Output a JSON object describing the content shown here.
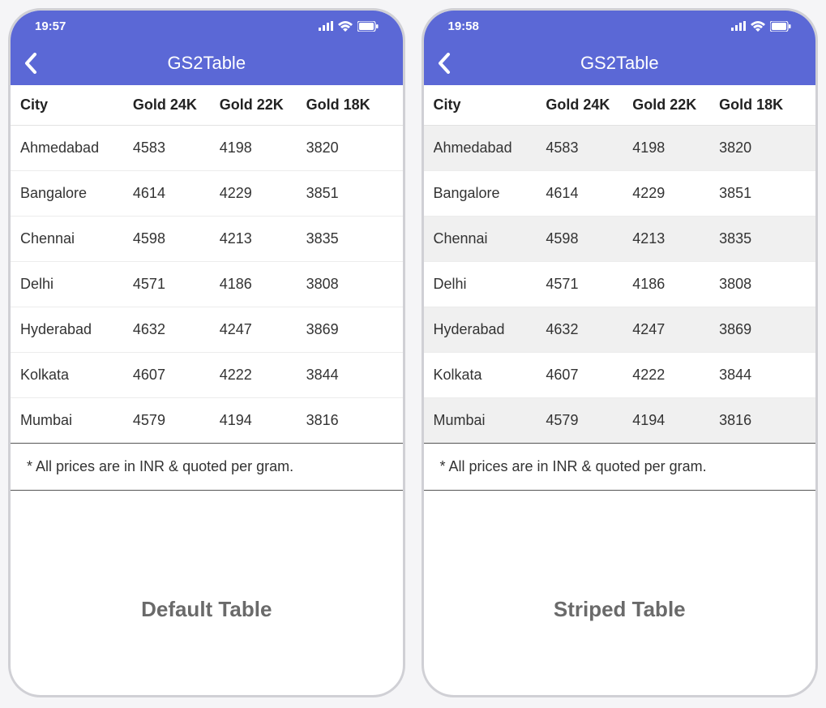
{
  "left": {
    "time": "19:57",
    "nav_title": "GS2Table",
    "columns": [
      "City",
      "Gold 24K",
      "Gold 22K",
      "Gold 18K"
    ],
    "rows": [
      {
        "c": [
          "Ahmedabad",
          "4583",
          "4198",
          "3820"
        ]
      },
      {
        "c": [
          "Bangalore",
          "4614",
          "4229",
          "3851"
        ]
      },
      {
        "c": [
          "Chennai",
          "4598",
          "4213",
          "3835"
        ]
      },
      {
        "c": [
          "Delhi",
          "4571",
          "4186",
          "3808"
        ]
      },
      {
        "c": [
          "Hyderabad",
          "4632",
          "4247",
          "3869"
        ]
      },
      {
        "c": [
          "Kolkata",
          "4607",
          "4222",
          "3844"
        ]
      },
      {
        "c": [
          "Mumbai",
          "4579",
          "4194",
          "3816"
        ]
      }
    ],
    "footnote": "* All prices are in INR & quoted per gram.",
    "caption": "Default Table"
  },
  "right": {
    "time": "19:58",
    "nav_title": "GS2Table",
    "columns": [
      "City",
      "Gold 24K",
      "Gold 22K",
      "Gold 18K"
    ],
    "rows": [
      {
        "c": [
          "Ahmedabad",
          "4583",
          "4198",
          "3820"
        ]
      },
      {
        "c": [
          "Bangalore",
          "4614",
          "4229",
          "3851"
        ]
      },
      {
        "c": [
          "Chennai",
          "4598",
          "4213",
          "3835"
        ]
      },
      {
        "c": [
          "Delhi",
          "4571",
          "4186",
          "3808"
        ]
      },
      {
        "c": [
          "Hyderabad",
          "4632",
          "4247",
          "3869"
        ]
      },
      {
        "c": [
          "Kolkata",
          "4607",
          "4222",
          "3844"
        ]
      },
      {
        "c": [
          "Mumbai",
          "4579",
          "4194",
          "3816"
        ]
      }
    ],
    "footnote": "* All prices are in INR & quoted per gram.",
    "caption": "Striped Table"
  }
}
